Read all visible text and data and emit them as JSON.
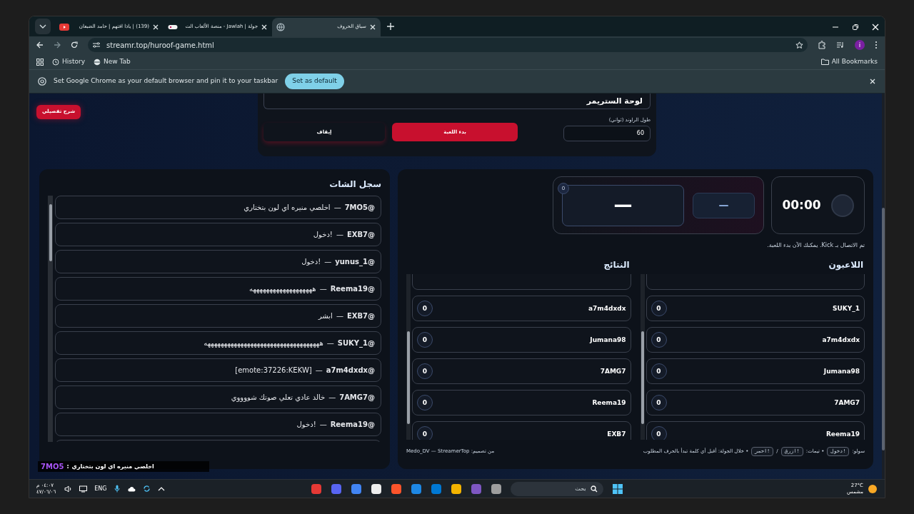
{
  "browser": {
    "tabs": [
      {
        "title": "سباق الحروف",
        "selected": true,
        "kind": "grid"
      },
      {
        "title": "جولة | Jawlah - منصة الألعاب الت",
        "selected": false,
        "kind": "game"
      },
      {
        "title": "(139) | ياذا افتهم | حامد الضبعان",
        "selected": false,
        "kind": "video"
      }
    ],
    "address": "streamr.top/huroof-game.html",
    "bookmarks": [
      {
        "label": "New Tab",
        "kind": "globe"
      },
      {
        "label": "History",
        "kind": "history"
      }
    ],
    "all_bookmarks": "All Bookmarks",
    "profile_initial": "i",
    "infobar": {
      "message": "Set Google Chrome as your default browser and pin it to your taskbar",
      "button": "Set as default"
    }
  },
  "page": {
    "help_button": "شرح تفصيلي",
    "control_panel": {
      "title": "لوحة الستريمر",
      "round_length_label": "طول الراوند (ثواني)",
      "round_length_value": "60",
      "start_button": "بدء اللعبة",
      "stop_button": "إيقاف"
    },
    "chat": {
      "title": "سجل الشات",
      "separator": "—",
      "messages": [
        {
          "user": "@7MO5",
          "text": "اخلصي منيره اي لون بتختاري"
        },
        {
          "user": "@EXB7",
          "text": "!دخول"
        },
        {
          "user": "@yunus_1",
          "text": "!دخول"
        },
        {
          "user": "@Reema19",
          "text": "هههههههههههههههههههه"
        },
        {
          "user": "@EXB7",
          "text": "ابشر"
        },
        {
          "user": "@SUKY_1",
          "text": "هههههههههههههههههههههههههههههههههههه"
        },
        {
          "user": "@a7m4dxdx",
          "text": "[emote:37226:KEKW]"
        },
        {
          "user": "@7AMG7",
          "text": "خالد عادي تعلي صوتك شووووي"
        },
        {
          "user": "@Reema19",
          "text": "!دخول"
        }
      ]
    },
    "game": {
      "timer": "00:00",
      "word_display": "—",
      "word_badge": "0",
      "letter_display": "—",
      "status": "تم الاتصال بـ Kick. يمكنك الآن بدء اللعبة.",
      "players": {
        "title": "اللاعبون",
        "rows": [
          {
            "name": "SUKY_1",
            "score": "0"
          },
          {
            "name": "a7m4dxdx",
            "score": "0"
          },
          {
            "name": "Jumana98",
            "score": "0"
          },
          {
            "name": "7AMG7",
            "score": "0"
          },
          {
            "name": "Reema19",
            "score": "0"
          }
        ]
      },
      "results": {
        "title": "النتائج",
        "rows": [
          {
            "name": "a7m4dxdx",
            "score": "0"
          },
          {
            "name": "Jumana98",
            "score": "0"
          },
          {
            "name": "7AMG7",
            "score": "0"
          },
          {
            "name": "Reema19",
            "score": "0"
          },
          {
            "name": "EXB7",
            "score": "0"
          }
        ]
      },
      "help_line": [
        {
          "kind": "text",
          "text": "سولو:"
        },
        {
          "kind": "kbd",
          "text": "!دخول"
        },
        {
          "kind": "text",
          "text": "• تيمات:"
        },
        {
          "kind": "kbd",
          "text": "!ازرق"
        },
        {
          "kind": "text",
          "text": "/"
        },
        {
          "kind": "kbd",
          "text": "!احمر"
        },
        {
          "kind": "text",
          "text": "• خلال الجولة: أقبل أي كلمة تبدأ بالحرف المطلوب"
        }
      ],
      "credit": "من تصميم: Medo_DV — StreamerTop"
    },
    "overlay": {
      "user": "7MO5",
      "separator": ":",
      "message": "اخلصي منيره اي لون بتختاري"
    }
  },
  "taskbar": {
    "time": "٠٤:٠٧ م",
    "date": "٤٧/٠٦/٠٦",
    "language": "ENG",
    "search_placeholder": "بحث",
    "weather": {
      "temp": "27°C",
      "condition": "مشمس"
    }
  }
}
